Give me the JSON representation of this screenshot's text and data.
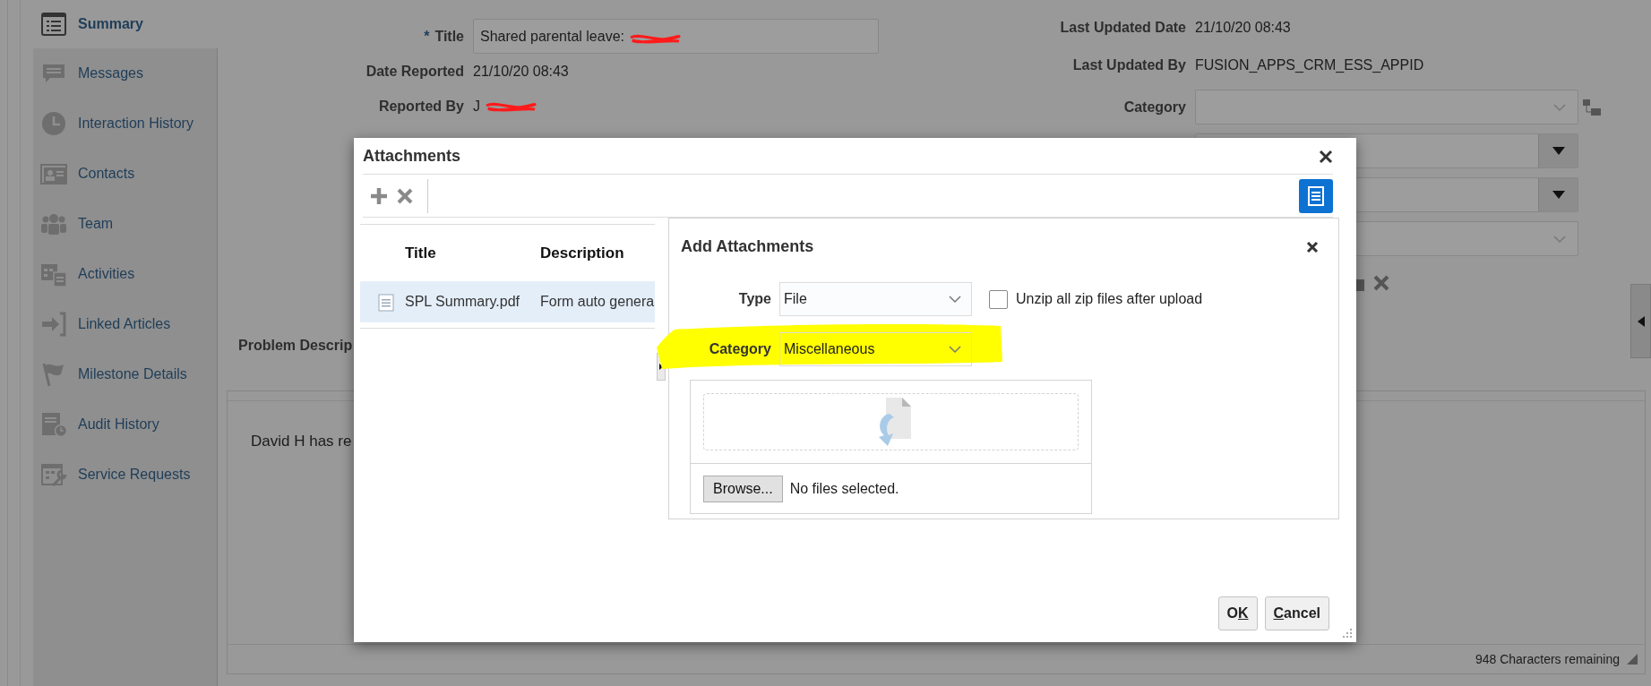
{
  "sidebar": {
    "items": [
      {
        "label": "Summary",
        "selected": true
      },
      {
        "label": "Messages",
        "selected": false
      },
      {
        "label": "Interaction History",
        "selected": false
      },
      {
        "label": "Contacts",
        "selected": false
      },
      {
        "label": "Team",
        "selected": false
      },
      {
        "label": "Activities",
        "selected": false
      },
      {
        "label": "Linked Articles",
        "selected": false
      },
      {
        "label": "Milestone Details",
        "selected": false
      },
      {
        "label": "Audit History",
        "selected": false
      },
      {
        "label": "Service Requests",
        "selected": false
      }
    ]
  },
  "form": {
    "left_fields": [
      {
        "kind": "input",
        "label": "Title",
        "required_mark": "*",
        "value": "Shared parental leave:",
        "redacted": true
      },
      {
        "kind": "text",
        "label": "Date Reported",
        "value": "21/10/20 08:43"
      },
      {
        "kind": "text",
        "label": "Reported By",
        "value": "J",
        "redacted": true
      }
    ],
    "right_fields": [
      {
        "kind": "text",
        "label": "Last Updated Date",
        "value": "21/10/20 08:43"
      },
      {
        "kind": "text",
        "label": "Last Updated By",
        "value": "FUSION_APPS_CRM_ESS_APPID"
      },
      {
        "kind": "select",
        "label": "Category"
      },
      {
        "kind": "dropdown"
      },
      {
        "kind": "dropdown"
      },
      {
        "kind": "select"
      }
    ]
  },
  "problem_description": {
    "label": "Problem Descrip",
    "text": "David H has re",
    "counter": "948 Characters remaining"
  },
  "dialog": {
    "title": "Attachments",
    "table": {
      "columns": [
        "Title",
        "Description"
      ],
      "rows": [
        {
          "title": "SPL Summary.pdf",
          "description": "Form auto genera",
          "selected": true
        }
      ]
    },
    "add_panel": {
      "title": "Add Attachments",
      "type": {
        "label": "Type",
        "value": "File"
      },
      "unzip": {
        "label": "Unzip all zip files after upload",
        "checked": false
      },
      "category": {
        "label": "Category",
        "value": "Miscellaneous",
        "highlighted": true
      },
      "browse_button": "Browse...",
      "file_status": "No files selected."
    },
    "buttons": [
      {
        "before": "O",
        "mnemonic": "K"
      },
      {
        "mnemonic": "C",
        "after": "ancel"
      }
    ]
  }
}
